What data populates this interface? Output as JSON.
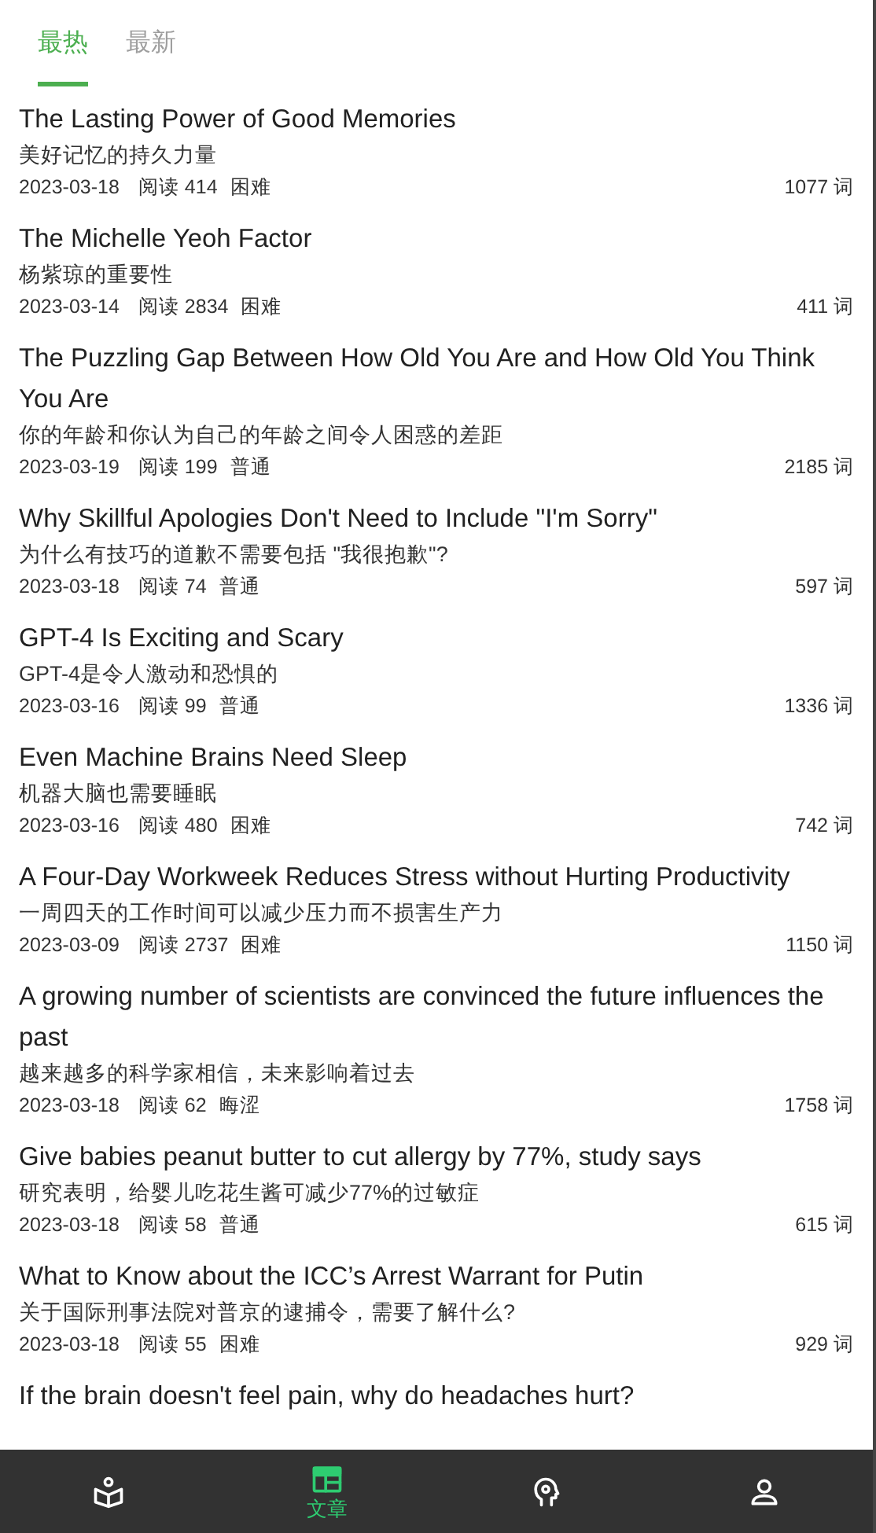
{
  "tabs": [
    {
      "label": "最热",
      "selected": true
    },
    {
      "label": "最新",
      "selected": false
    }
  ],
  "articles": [
    {
      "title": "The Lasting Power of Good Memories",
      "subtitle": "美好记忆的持久力量",
      "date": "2023-03-18",
      "reads": "阅读 414",
      "level": "困难",
      "words": "1077 词"
    },
    {
      "title": "The Michelle Yeoh Factor",
      "subtitle": "杨紫琼的重要性",
      "date": "2023-03-14",
      "reads": "阅读 2834",
      "level": "困难",
      "words": "411 词"
    },
    {
      "title": "The Puzzling Gap Between How Old You Are and How Old You Think You Are",
      "subtitle": "你的年龄和你认为自己的年龄之间令人困惑的差距",
      "date": "2023-03-19",
      "reads": "阅读 199",
      "level": "普通",
      "words": "2185 词"
    },
    {
      "title": "Why Skillful Apologies Don't Need to Include \"I'm Sorry\"",
      "subtitle": "为什么有技巧的道歉不需要包括 \"我很抱歉\"?",
      "date": "2023-03-18",
      "reads": "阅读 74",
      "level": "普通",
      "words": "597 词"
    },
    {
      "title": "GPT-4 Is Exciting and Scary",
      "subtitle": "GPT-4是令人激动和恐惧的",
      "date": "2023-03-16",
      "reads": "阅读 99",
      "level": "普通",
      "words": "1336 词"
    },
    {
      "title": "Even Machine Brains Need Sleep",
      "subtitle": "机器大脑也需要睡眠",
      "date": "2023-03-16",
      "reads": "阅读 480",
      "level": "困难",
      "words": "742 词"
    },
    {
      "title": "A Four-Day Workweek Reduces Stress without Hurting Productivity",
      "subtitle": "一周四天的工作时间可以减少压力而不损害生产力",
      "date": "2023-03-09",
      "reads": "阅读 2737",
      "level": "困难",
      "words": "1150 词"
    },
    {
      "title": "A growing number of scientists are convinced the future influences the past",
      "subtitle": "越来越多的科学家相信，未来影响着过去",
      "date": "2023-03-18",
      "reads": "阅读 62",
      "level": "晦涩",
      "words": "1758 词"
    },
    {
      "title": "Give babies peanut butter to cut allergy by 77%, study says",
      "subtitle": "研究表明，给婴儿吃花生酱可减少77%的过敏症",
      "date": "2023-03-18",
      "reads": "阅读 58",
      "level": "普通",
      "words": "615 词"
    },
    {
      "title": "What to Know about the ICC’s Arrest Warrant for Putin",
      "subtitle": "关于国际刑事法院对普京的逮捕令，需要了解什么?",
      "date": "2023-03-18",
      "reads": "阅读 55",
      "level": "困难",
      "words": "929 词"
    },
    {
      "title": "If the brain doesn't feel pain, why do headaches hurt?"
    }
  ],
  "nav": [
    {
      "selected": false
    },
    {
      "label": "文章",
      "selected": true
    },
    {
      "selected": false
    },
    {
      "selected": false
    }
  ]
}
